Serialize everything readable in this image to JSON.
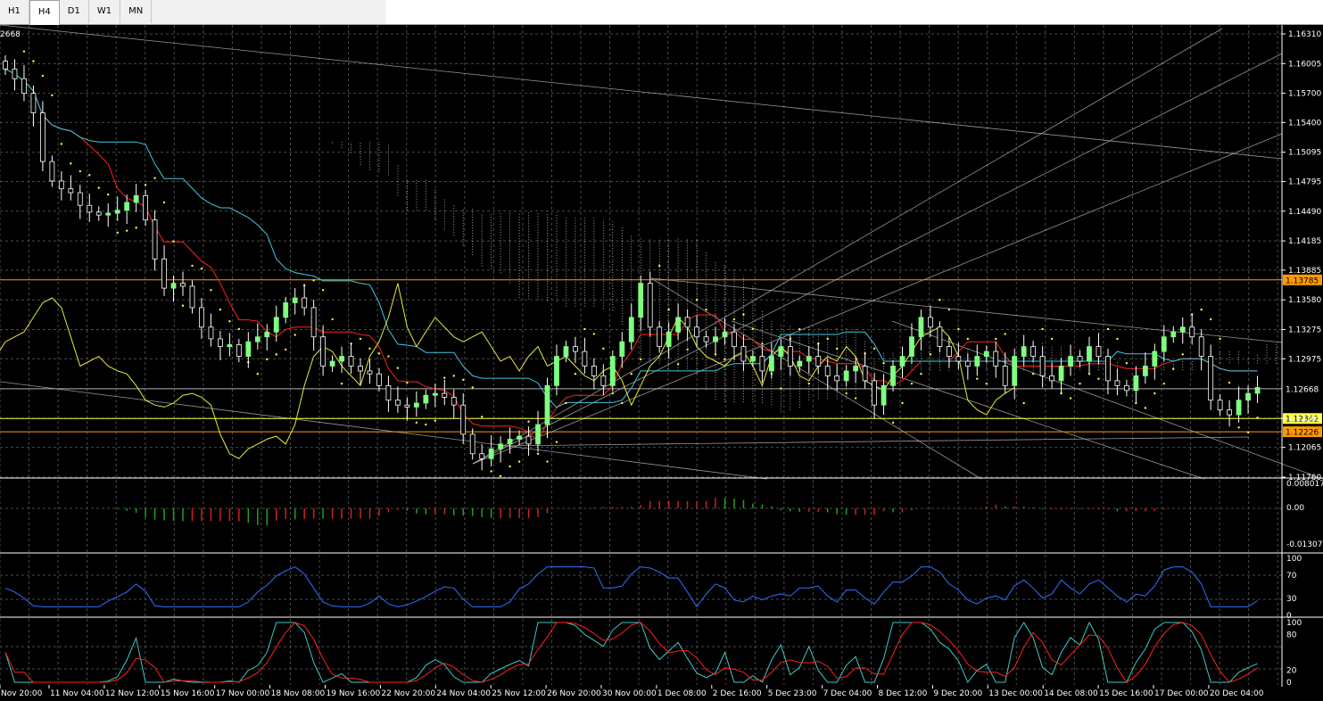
{
  "toolbar": {
    "tabs": [
      {
        "label": "H1",
        "active": false
      },
      {
        "label": "H4",
        "active": true
      },
      {
        "label": "D1",
        "active": false
      },
      {
        "label": "W1",
        "active": false
      },
      {
        "label": "MN",
        "active": false
      }
    ]
  },
  "colors": {
    "background": "#000000",
    "grid": "#4a4a4a",
    "bull_candle": "#ffffff",
    "bull_candle_fill": "#7fff7f",
    "tenkan": "#ff2020",
    "kijun": "#40c8e0",
    "chikou": "#e8e840",
    "cloud": "#c8c8c8",
    "orange_level": "#ff9900",
    "yellow_level": "#ffff40",
    "macd_up": "#20a020",
    "macd_down": "#d02020",
    "rsi_line": "#3070ff",
    "stoch_main": "#40c8c8",
    "stoch_signal": "#ff2020"
  },
  "current_price_text": "2668",
  "chart_data": [
    {
      "type": "candlestick",
      "panel": "price",
      "indicators": [
        "Ichimoku Kinko Hyo",
        "Parabolic SAR",
        "Fractals"
      ],
      "x_labels": [
        "Nov 20:00",
        "11 Nov 04:00",
        "12 Nov 12:00",
        "15 Nov 16:00",
        "17 Nov 00:00",
        "18 Nov 08:00",
        "19 Nov 16:00",
        "22 Nov 20:00",
        "24 Nov 04:00",
        "25 Nov 12:00",
        "26 Nov 20:00",
        "30 Nov 00:00",
        "1 Dec 08:00",
        "2 Dec 16:00",
        "5 Dec 23:00",
        "7 Dec 04:00",
        "8 Dec 12:00",
        "9 Dec 20:00",
        "13 Dec 00:00",
        "14 Dec 08:00",
        "15 Dec 16:00",
        "17 Dec 00:00",
        "20 Dec 04:00"
      ],
      "y_ticks": [
        "1.16310",
        "1.16005",
        "1.15700",
        "1.15400",
        "1.15095",
        "1.14795",
        "1.14490",
        "1.14185",
        "1.13885",
        "1.13580",
        "1.13275",
        "1.12975",
        "1.12365",
        "1.12065",
        "1.11760"
      ],
      "ylim": [
        1.1176,
        1.1631
      ],
      "price_labels": [
        {
          "text": "1.13785",
          "value": 1.13785,
          "color": "orange"
        },
        {
          "text": "1.12668",
          "value": 1.12668,
          "color": "gray"
        },
        {
          "text": "1.12362",
          "value": 1.12362,
          "color": "yellow"
        },
        {
          "text": "1.12226",
          "value": 1.12226,
          "color": "orange"
        }
      ],
      "close_series": [
        1.1595,
        1.1585,
        1.157,
        1.155,
        1.15,
        1.148,
        1.1472,
        1.1468,
        1.1455,
        1.1448,
        1.1445,
        1.1447,
        1.145,
        1.1458,
        1.1465,
        1.144,
        1.14,
        1.137,
        1.1375,
        1.1372,
        1.135,
        1.133,
        1.1318,
        1.131,
        1.1312,
        1.13,
        1.1315,
        1.132,
        1.1325,
        1.134,
        1.1355,
        1.136,
        1.135,
        1.132,
        1.129,
        1.1295,
        1.13,
        1.129,
        1.1285,
        1.1282,
        1.127,
        1.1255,
        1.125,
        1.1248,
        1.1252,
        1.126,
        1.1262,
        1.1258,
        1.125,
        1.122,
        1.12,
        1.1195,
        1.1205,
        1.121,
        1.1215,
        1.1218,
        1.121,
        1.123,
        1.127,
        1.13,
        1.131,
        1.1305,
        1.129,
        1.128,
        1.127,
        1.13,
        1.1315,
        1.134,
        1.1375,
        1.133,
        1.131,
        1.1325,
        1.134,
        1.133,
        1.132,
        1.1315,
        1.132,
        1.1325,
        1.131,
        1.1295,
        1.13,
        1.1285,
        1.13,
        1.131,
        1.129,
        1.1295,
        1.13,
        1.129,
        1.128,
        1.1275,
        1.1285,
        1.129,
        1.1275,
        1.125,
        1.127,
        1.129,
        1.13,
        1.132,
        1.134,
        1.133,
        1.131,
        1.13,
        1.1295,
        1.129,
        1.13,
        1.1305,
        1.129,
        1.127,
        1.13,
        1.131,
        1.13,
        1.128,
        1.1275,
        1.129,
        1.13,
        1.1295,
        1.131,
        1.13,
        1.1275,
        1.127,
        1.1265,
        1.128,
        1.129,
        1.1305,
        1.132,
        1.1325,
        1.133,
        1.132,
        1.13,
        1.1255,
        1.1245,
        1.124,
        1.1255,
        1.1262,
        1.1268
      ]
    },
    {
      "type": "bar",
      "panel": "macd",
      "y_ticks": [
        "0.008017",
        "0.00",
        "-0.013079"
      ],
      "ylim": [
        -0.013079,
        0.008017
      ]
    },
    {
      "type": "line",
      "panel": "rsi",
      "y_ticks": [
        "100",
        "70",
        "30",
        "0"
      ],
      "ylim": [
        0,
        100
      ]
    },
    {
      "type": "line",
      "panel": "stochastic",
      "y_ticks": [
        "100",
        "80",
        "20",
        "0"
      ],
      "ylim": [
        0,
        100
      ]
    }
  ]
}
